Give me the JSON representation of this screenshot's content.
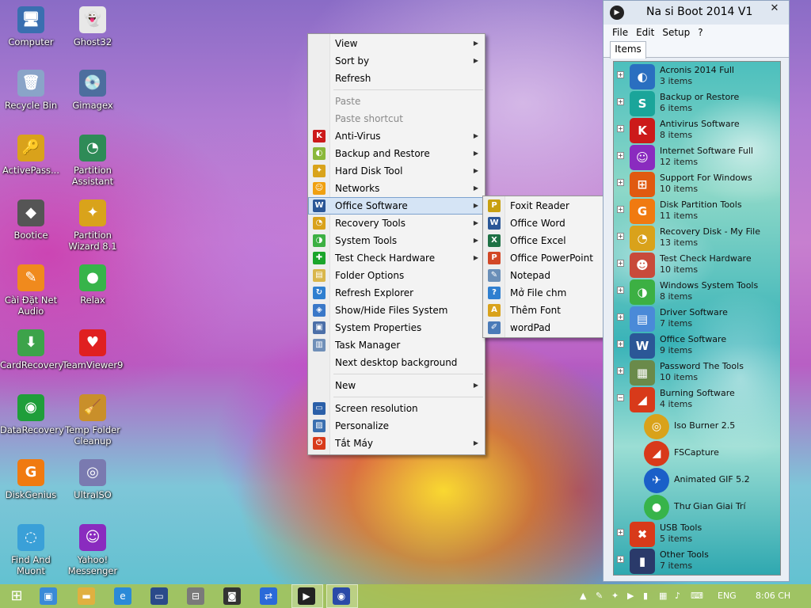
{
  "desktop": {
    "icons": [
      {
        "label": "Computer",
        "glyph": "🖥",
        "color": "#3a6fb0"
      },
      {
        "label": "Ghost32",
        "glyph": "👻",
        "color": "#e8e8e8"
      },
      {
        "label": "Recycle Bin",
        "glyph": "🗑",
        "color": "#8aa4c8"
      },
      {
        "label": "Gimagex",
        "glyph": "💿",
        "color": "#4d6e9e"
      },
      {
        "label": "ActivePass...",
        "glyph": "🔑",
        "color": "#d9a21b"
      },
      {
        "label": "Partition Assistant",
        "glyph": "◔",
        "color": "#2e8b57"
      },
      {
        "label": "Bootice",
        "glyph": "◆",
        "color": "#555555"
      },
      {
        "label": "Partition Wizard 8.1",
        "glyph": "✦",
        "color": "#d9a31b"
      },
      {
        "label": "Cài Đặt Net Audio",
        "glyph": "✎",
        "color": "#f08a1d"
      },
      {
        "label": "Relax",
        "glyph": "●",
        "color": "#37b44a"
      },
      {
        "label": "CardRecovery",
        "glyph": "⬇",
        "color": "#3da34a"
      },
      {
        "label": "TeamViewer9",
        "glyph": "♥",
        "color": "#e02020"
      },
      {
        "label": "DataRecovery",
        "glyph": "◉",
        "color": "#1f9e3a"
      },
      {
        "label": "Temp Folder Cleanup",
        "glyph": "🧹",
        "color": "#c98f2a"
      },
      {
        "label": "DiskGenius",
        "glyph": "G",
        "color": "#f07a10"
      },
      {
        "label": "UltraISO",
        "glyph": "◎",
        "color": "#7a7ab0"
      },
      {
        "label": "Find And Muont",
        "glyph": "◌",
        "color": "#3aa0d8"
      },
      {
        "label": "Yahoo! Messenger",
        "glyph": "☺",
        "color": "#8a2bbf"
      }
    ]
  },
  "context_menu": {
    "items": [
      {
        "label": "View",
        "submenu": true
      },
      {
        "label": "Sort by",
        "submenu": true
      },
      {
        "label": "Refresh"
      },
      {
        "sep": true
      },
      {
        "label": "Paste",
        "disabled": true
      },
      {
        "label": "Paste shortcut",
        "disabled": true
      },
      {
        "label": "Anti-Virus",
        "submenu": true,
        "icon": "anti-virus-icon",
        "glyph": "K",
        "color": "#cc1a1a"
      },
      {
        "label": "Backup and Restore",
        "submenu": true,
        "icon": "backup-icon",
        "glyph": "◐",
        "color": "#8ab83a"
      },
      {
        "label": "Hard Disk Tool",
        "submenu": true,
        "icon": "hard-disk-icon",
        "glyph": "✦",
        "color": "#d9a31b"
      },
      {
        "label": "Networks",
        "submenu": true,
        "icon": "networks-icon",
        "glyph": "☺",
        "color": "#f0a010"
      },
      {
        "label": "Office Software",
        "submenu": true,
        "highlighted": true,
        "icon": "word-icon",
        "glyph": "W",
        "color": "#2b5797"
      },
      {
        "label": "Recovery Tools",
        "submenu": true,
        "icon": "recovery-icon",
        "glyph": "◔",
        "color": "#d9a21b"
      },
      {
        "label": "System Tools",
        "submenu": true,
        "icon": "system-tools-icon",
        "glyph": "◑",
        "color": "#3cb043"
      },
      {
        "label": "Test Check Hardware",
        "submenu": true,
        "icon": "plus-icon",
        "glyph": "✚",
        "color": "#1aa52a"
      },
      {
        "label": "Folder Options",
        "icon": "folder-options-icon",
        "glyph": "▤",
        "color": "#d9b64a"
      },
      {
        "label": "Refresh Explorer",
        "icon": "refresh-explorer-icon",
        "glyph": "↻",
        "color": "#2f7fd0"
      },
      {
        "label": "Show/Hide Files System",
        "icon": "shield-icon",
        "glyph": "◈",
        "color": "#3a78c8"
      },
      {
        "label": "System Properties",
        "icon": "system-properties-icon",
        "glyph": "▣",
        "color": "#4b6fa8"
      },
      {
        "label": "Task Manager",
        "icon": "task-manager-icon",
        "glyph": "▥",
        "color": "#6f8fb8"
      },
      {
        "label": "Next desktop background"
      },
      {
        "sep": true
      },
      {
        "label": "New",
        "submenu": true
      },
      {
        "sep": true
      },
      {
        "label": "Screen resolution",
        "icon": "screen-resolution-icon",
        "glyph": "▭",
        "color": "#2a5fa8"
      },
      {
        "label": "Personalize",
        "icon": "personalize-icon",
        "glyph": "▨",
        "color": "#3a6fb0"
      },
      {
        "label": "Tắt Máy",
        "submenu": true,
        "icon": "power-icon",
        "glyph": "⏻",
        "color": "#d83a1a"
      }
    ]
  },
  "submenu": {
    "items": [
      {
        "label": "Foxit Reader",
        "icon": "foxit-icon",
        "glyph": "P",
        "color": "#c8a010"
      },
      {
        "label": "Office Word",
        "icon": "word-icon",
        "glyph": "W",
        "color": "#2b5797"
      },
      {
        "label": "Office Excel",
        "icon": "excel-icon",
        "glyph": "X",
        "color": "#1e7145"
      },
      {
        "label": "Office PowerPoint",
        "icon": "powerpoint-icon",
        "glyph": "P",
        "color": "#d24726"
      },
      {
        "label": "Notepad",
        "icon": "notepad-icon",
        "glyph": "✎",
        "color": "#6a8fb8"
      },
      {
        "label": "Mở File chm",
        "icon": "chm-icon",
        "glyph": "?",
        "color": "#2f7fd0"
      },
      {
        "label": "Thêm Font",
        "icon": "font-icon",
        "glyph": "A",
        "color": "#d9a21b"
      },
      {
        "label": "wordPad",
        "icon": "wordpad-icon",
        "glyph": "✐",
        "color": "#4a7ab8"
      }
    ]
  },
  "app": {
    "title": "Na si Boot 2014 V1",
    "close": "✕",
    "menus": [
      "File",
      "Edit",
      "Setup",
      "?"
    ],
    "tab": "Items",
    "tree": [
      {
        "name": "Acronis 2014 Full",
        "count": "3 items",
        "glyph": "◐",
        "color": "#2a6fc0",
        "toggle": "+"
      },
      {
        "name": "Backup or Restore",
        "count": "6 items",
        "glyph": "S",
        "color": "#1aa59a",
        "toggle": "+"
      },
      {
        "name": "Antivirus Software",
        "count": "8 items",
        "glyph": "K",
        "color": "#cc1a1a",
        "toggle": "+"
      },
      {
        "name": "Internet Software Full",
        "count": "12 items",
        "glyph": "☺",
        "color": "#8a2bbf",
        "toggle": "+"
      },
      {
        "name": "Support For Windows",
        "count": "10 items",
        "glyph": "⊞",
        "color": "#e05a10",
        "toggle": "+"
      },
      {
        "name": "Disk Partition Tools",
        "count": "11 items",
        "glyph": "G",
        "color": "#f07a10",
        "toggle": "+"
      },
      {
        "name": "Recovery Disk - My File",
        "count": "13 items",
        "glyph": "◔",
        "color": "#d9a21b",
        "toggle": "+"
      },
      {
        "name": "Test Check Hardware",
        "count": "10 items",
        "glyph": "☻",
        "color": "#c84a3a",
        "toggle": "+"
      },
      {
        "name": "Windows System Tools",
        "count": "8 items",
        "glyph": "◑",
        "color": "#3cb043",
        "toggle": "+"
      },
      {
        "name": "Driver Software",
        "count": "7 items",
        "glyph": "▤",
        "color": "#4a8ad8",
        "toggle": "+"
      },
      {
        "name": "Office Software",
        "count": "9 items",
        "glyph": "W",
        "color": "#2b5797",
        "toggle": "+"
      },
      {
        "name": "Password The Tools",
        "count": "10 items",
        "glyph": "▦",
        "color": "#6a8a4a",
        "toggle": "+"
      },
      {
        "name": "Burning Software",
        "count": "4 items",
        "glyph": "◢",
        "color": "#d83a1a",
        "toggle": "−",
        "children": [
          {
            "name": "Iso Burner 2.5",
            "glyph": "◎",
            "color": "#d9a21b"
          },
          {
            "name": "FSCapture",
            "glyph": "◢",
            "color": "#d83a1a"
          },
          {
            "name": "Animated GIF 5.2",
            "glyph": "✈",
            "color": "#1a5fc8"
          },
          {
            "name": "Thư Gian Giai Trí",
            "glyph": "●",
            "color": "#37b44a"
          }
        ]
      },
      {
        "name": "USB Tools",
        "count": "5 items",
        "glyph": "✖",
        "color": "#d83a1a",
        "toggle": "+"
      },
      {
        "name": "Other Tools",
        "count": "7 items",
        "glyph": "▮",
        "color": "#2a3a6a",
        "toggle": "+"
      }
    ]
  },
  "taskbar": {
    "start_glyph": "⊞",
    "apps": [
      {
        "name": "network-icon",
        "glyph": "▣",
        "color": "#3a8ad8"
      },
      {
        "name": "explorer-icon",
        "glyph": "▬",
        "color": "#e0b040"
      },
      {
        "name": "ie-icon",
        "glyph": "e",
        "color": "#2a8ad8"
      },
      {
        "name": "monitor-icon",
        "glyph": "▭",
        "color": "#2a4a8a"
      },
      {
        "name": "usb-icon",
        "glyph": "⊟",
        "color": "#7a7a7a"
      },
      {
        "name": "camera-icon",
        "glyph": "◙",
        "color": "#333333"
      },
      {
        "name": "teamviewer-icon",
        "glyph": "⇄",
        "color": "#2a6ad8"
      },
      {
        "name": "nasiboot-icon",
        "glyph": "▶",
        "color": "#222222"
      },
      {
        "name": "disc-icon",
        "glyph": "◉",
        "color": "#2a4aa8"
      }
    ],
    "language": "ENG",
    "time": "8:06 CH"
  }
}
